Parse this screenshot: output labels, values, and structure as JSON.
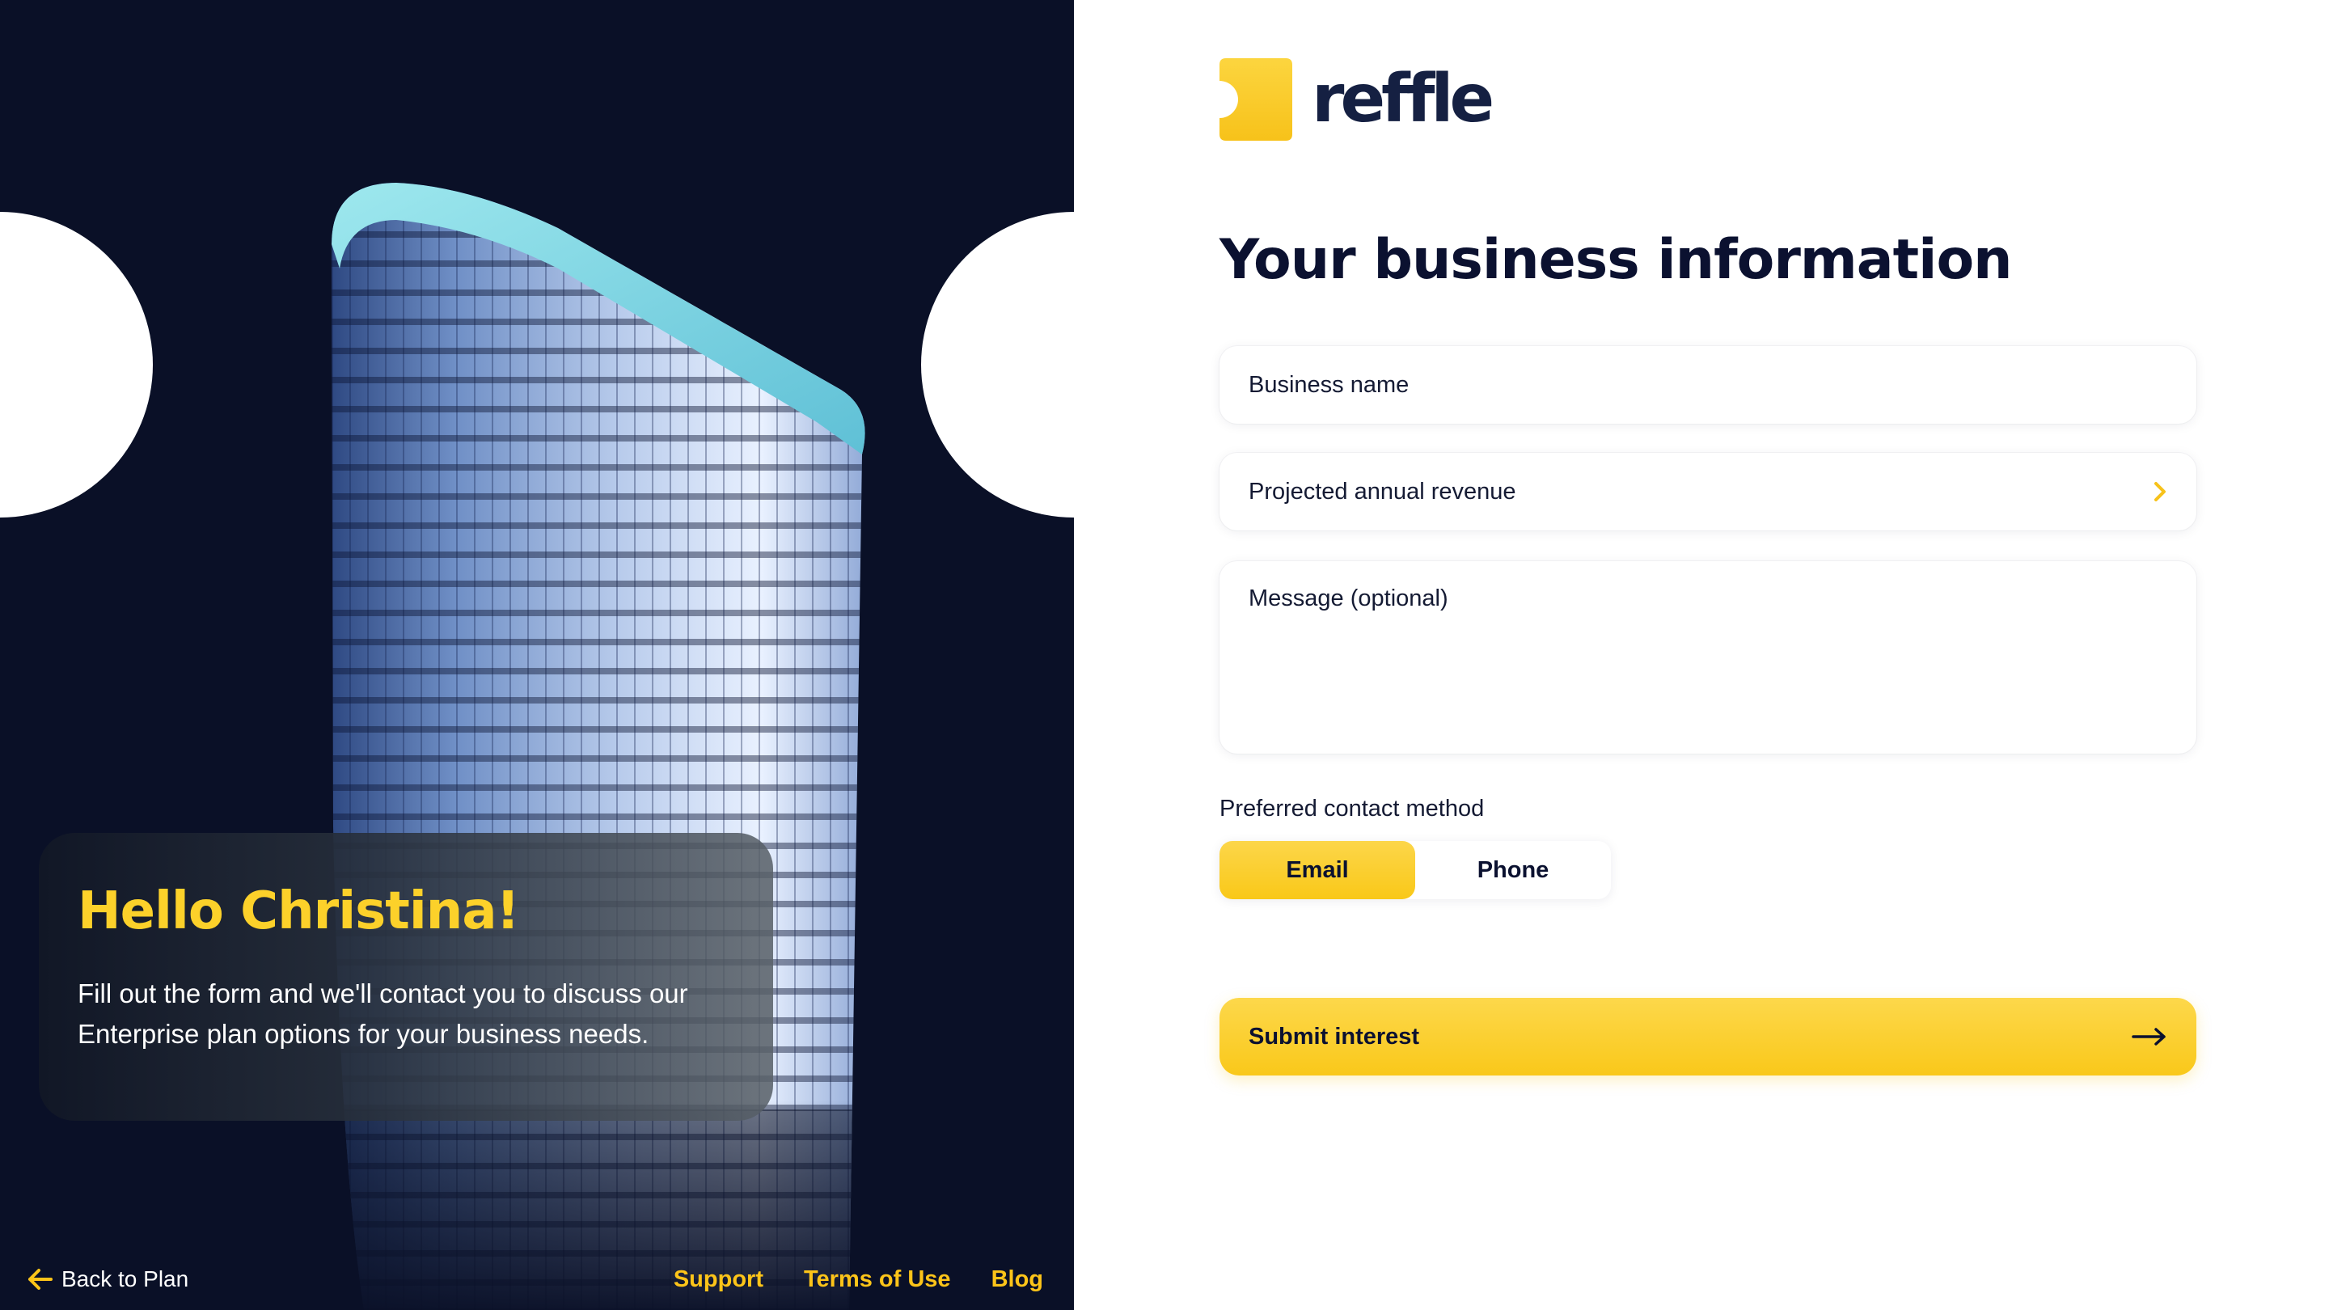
{
  "brand": {
    "name": "reffle",
    "accent": "#fcd12a",
    "dark": "#0a1027"
  },
  "hero": {
    "greeting": "Hello Christina!",
    "message": "Fill out the form and we'll contact you to discuss our Enterprise plan options for your business needs."
  },
  "nav": {
    "back_label": "Back to Plan",
    "links": [
      "Support",
      "Terms of Use",
      "Blog"
    ]
  },
  "form": {
    "title": "Your business information",
    "business_name_placeholder": "Business name",
    "revenue_placeholder": "Projected annual revenue",
    "message_placeholder": "Message (optional)",
    "contact_label": "Preferred contact method",
    "contact_options": [
      "Email",
      "Phone"
    ],
    "contact_selected": "Email",
    "submit_label": "Submit interest"
  },
  "icons": {
    "back": "arrow-left-icon",
    "revenue_chevron": "chevron-right-icon",
    "submit": "arrow-right-icon"
  }
}
